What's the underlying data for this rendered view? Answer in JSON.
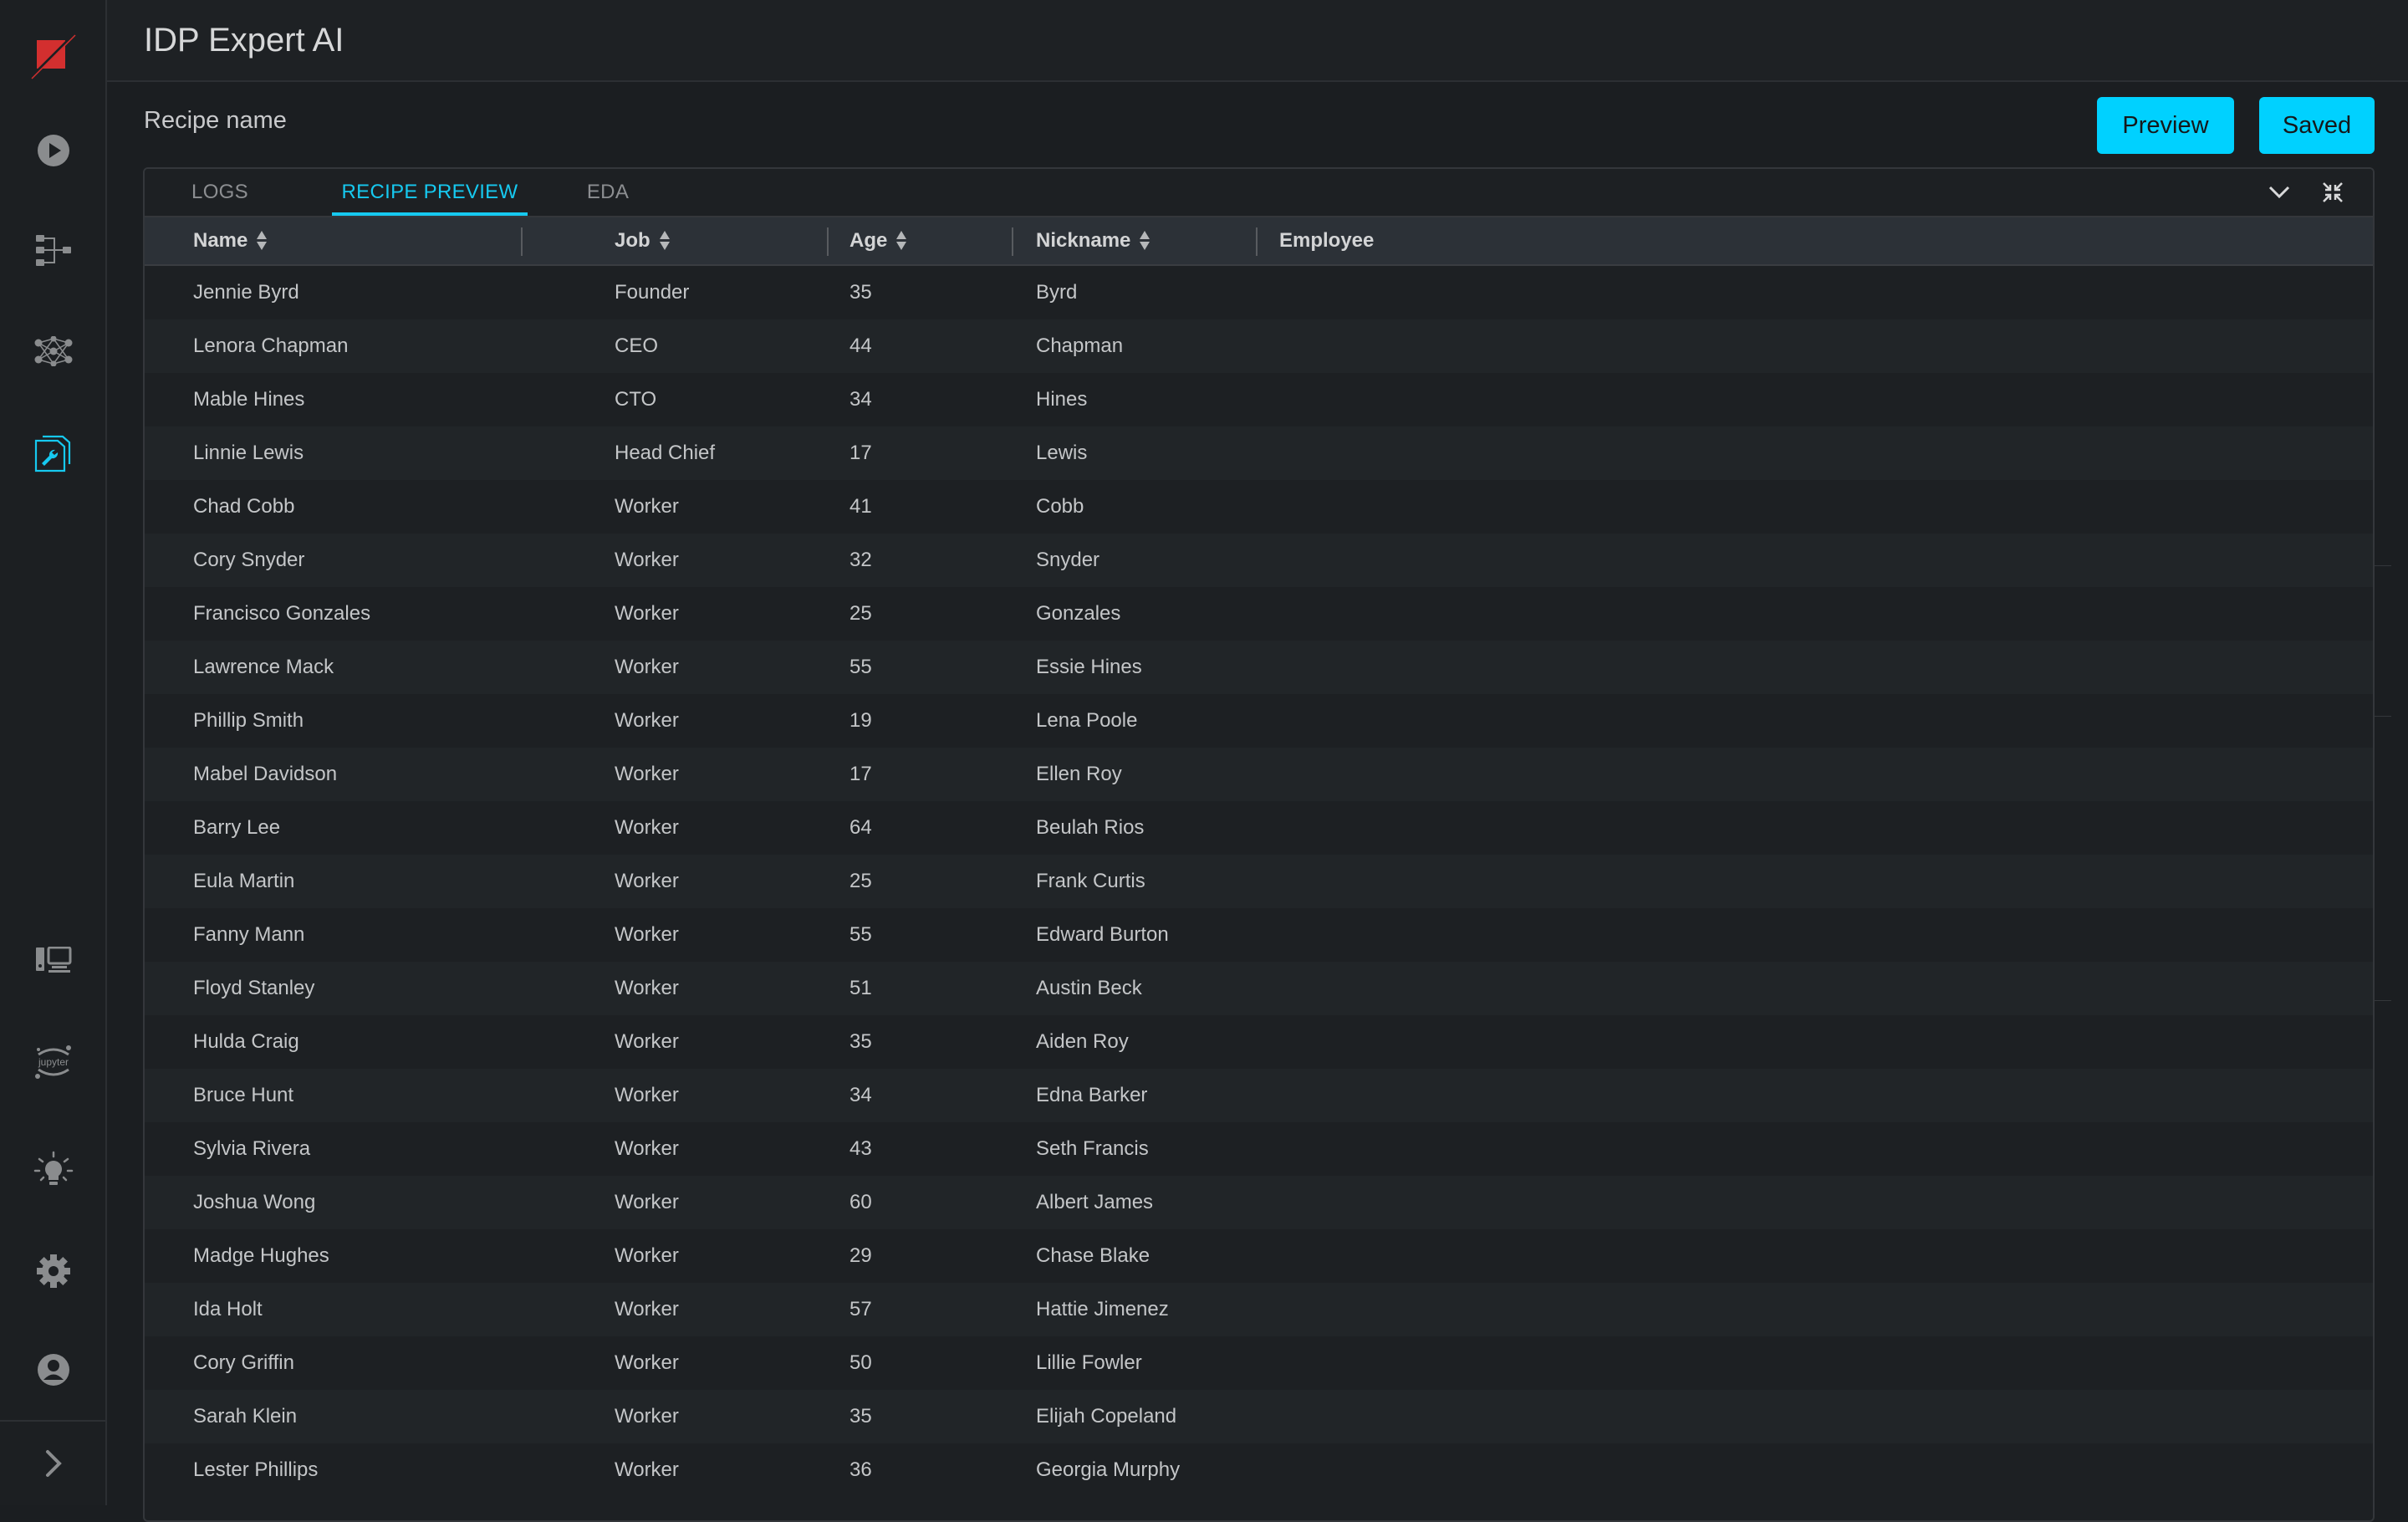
{
  "app": {
    "title": "IDP Expert AI"
  },
  "sidebar": {
    "top_items": [
      {
        "icon": "logo-icon",
        "label": "Logo"
      },
      {
        "icon": "play-icon",
        "label": "Run"
      },
      {
        "icon": "hierarchy-icon",
        "label": "Pipelines"
      },
      {
        "icon": "neural-network-icon",
        "label": "Models"
      },
      {
        "icon": "recipe-wrench-icon",
        "label": "Recipes",
        "active": true
      }
    ],
    "bottom_items": [
      {
        "icon": "desktop-icon",
        "label": "Workstation"
      },
      {
        "icon": "jupyter-icon",
        "label": "jupyter"
      },
      {
        "icon": "lightbulb-icon",
        "label": "Insights"
      },
      {
        "icon": "gear-icon",
        "label": "Settings"
      },
      {
        "icon": "user-icon",
        "label": "Profile"
      }
    ],
    "expand_icon": "chevron-right-icon"
  },
  "recipe": {
    "name_label": "Recipe name",
    "preview_button": "Preview",
    "saved_button": "Saved"
  },
  "colors": {
    "accent": "#00d1ff",
    "active_tab": "#16c9f0",
    "logo_red": "#d32f2f"
  },
  "tabs": [
    {
      "label": "LOGS",
      "active": false
    },
    {
      "label": "RECIPE PREVIEW",
      "active": true
    },
    {
      "label": "EDA",
      "active": false
    }
  ],
  "table": {
    "columns": [
      {
        "label": "Name",
        "sortable": true
      },
      {
        "label": "Job",
        "sortable": true
      },
      {
        "label": "Age",
        "sortable": true
      },
      {
        "label": "Nickname",
        "sortable": true
      },
      {
        "label": "Employee",
        "sortable": false
      }
    ],
    "rows": [
      {
        "name": "Jennie Byrd",
        "job": "Founder",
        "age": "35",
        "nickname": "Byrd",
        "employee": ""
      },
      {
        "name": "Lenora Chapman",
        "job": "CEO",
        "age": "44",
        "nickname": "Chapman",
        "employee": ""
      },
      {
        "name": "Mable Hines",
        "job": "CTO",
        "age": "34",
        "nickname": "Hines",
        "employee": ""
      },
      {
        "name": "Linnie Lewis",
        "job": "Head Chief",
        "age": "17",
        "nickname": "Lewis",
        "employee": ""
      },
      {
        "name": "Chad Cobb",
        "job": "Worker",
        "age": "41",
        "nickname": "Cobb",
        "employee": ""
      },
      {
        "name": "Cory Snyder",
        "job": "Worker",
        "age": "32",
        "nickname": "Snyder",
        "employee": ""
      },
      {
        "name": "Francisco Gonzales",
        "job": "Worker",
        "age": "25",
        "nickname": "Gonzales",
        "employee": ""
      },
      {
        "name": "Lawrence Mack",
        "job": "Worker",
        "age": "55",
        "nickname": "Essie Hines",
        "employee": ""
      },
      {
        "name": "Phillip Smith",
        "job": "Worker",
        "age": "19",
        "nickname": "Lena Poole",
        "employee": ""
      },
      {
        "name": "Mabel Davidson",
        "job": "Worker",
        "age": "17",
        "nickname": "Ellen Roy",
        "employee": ""
      },
      {
        "name": "Barry Lee",
        "job": "Worker",
        "age": "64",
        "nickname": "Beulah Rios",
        "employee": ""
      },
      {
        "name": "Eula Martin",
        "job": "Worker",
        "age": "25",
        "nickname": "Frank Curtis",
        "employee": ""
      },
      {
        "name": "Fanny Mann",
        "job": "Worker",
        "age": "55",
        "nickname": "Edward Burton",
        "employee": ""
      },
      {
        "name": "Floyd Stanley",
        "job": "Worker",
        "age": "51",
        "nickname": "Austin Beck",
        "employee": ""
      },
      {
        "name": "Hulda Craig",
        "job": "Worker",
        "age": "35",
        "nickname": "Aiden Roy",
        "employee": ""
      },
      {
        "name": "Bruce Hunt",
        "job": "Worker",
        "age": "34",
        "nickname": "Edna Barker",
        "employee": ""
      },
      {
        "name": "Sylvia Rivera",
        "job": "Worker",
        "age": "43",
        "nickname": "Seth Francis",
        "employee": ""
      },
      {
        "name": "Joshua Wong",
        "job": "Worker",
        "age": "60",
        "nickname": "Albert James",
        "employee": ""
      },
      {
        "name": "Madge Hughes",
        "job": "Worker",
        "age": "29",
        "nickname": "Chase Blake",
        "employee": ""
      },
      {
        "name": "Ida Holt",
        "job": "Worker",
        "age": "57",
        "nickname": "Hattie Jimenez",
        "employee": ""
      },
      {
        "name": "Cory Griffin",
        "job": "Worker",
        "age": "50",
        "nickname": "Lillie Fowler",
        "employee": ""
      },
      {
        "name": "Sarah Klein",
        "job": "Worker",
        "age": "35",
        "nickname": "Elijah Copeland",
        "employee": ""
      },
      {
        "name": "Lester Phillips",
        "job": "Worker",
        "age": "36",
        "nickname": "Georgia Murphy",
        "employee": ""
      }
    ]
  }
}
